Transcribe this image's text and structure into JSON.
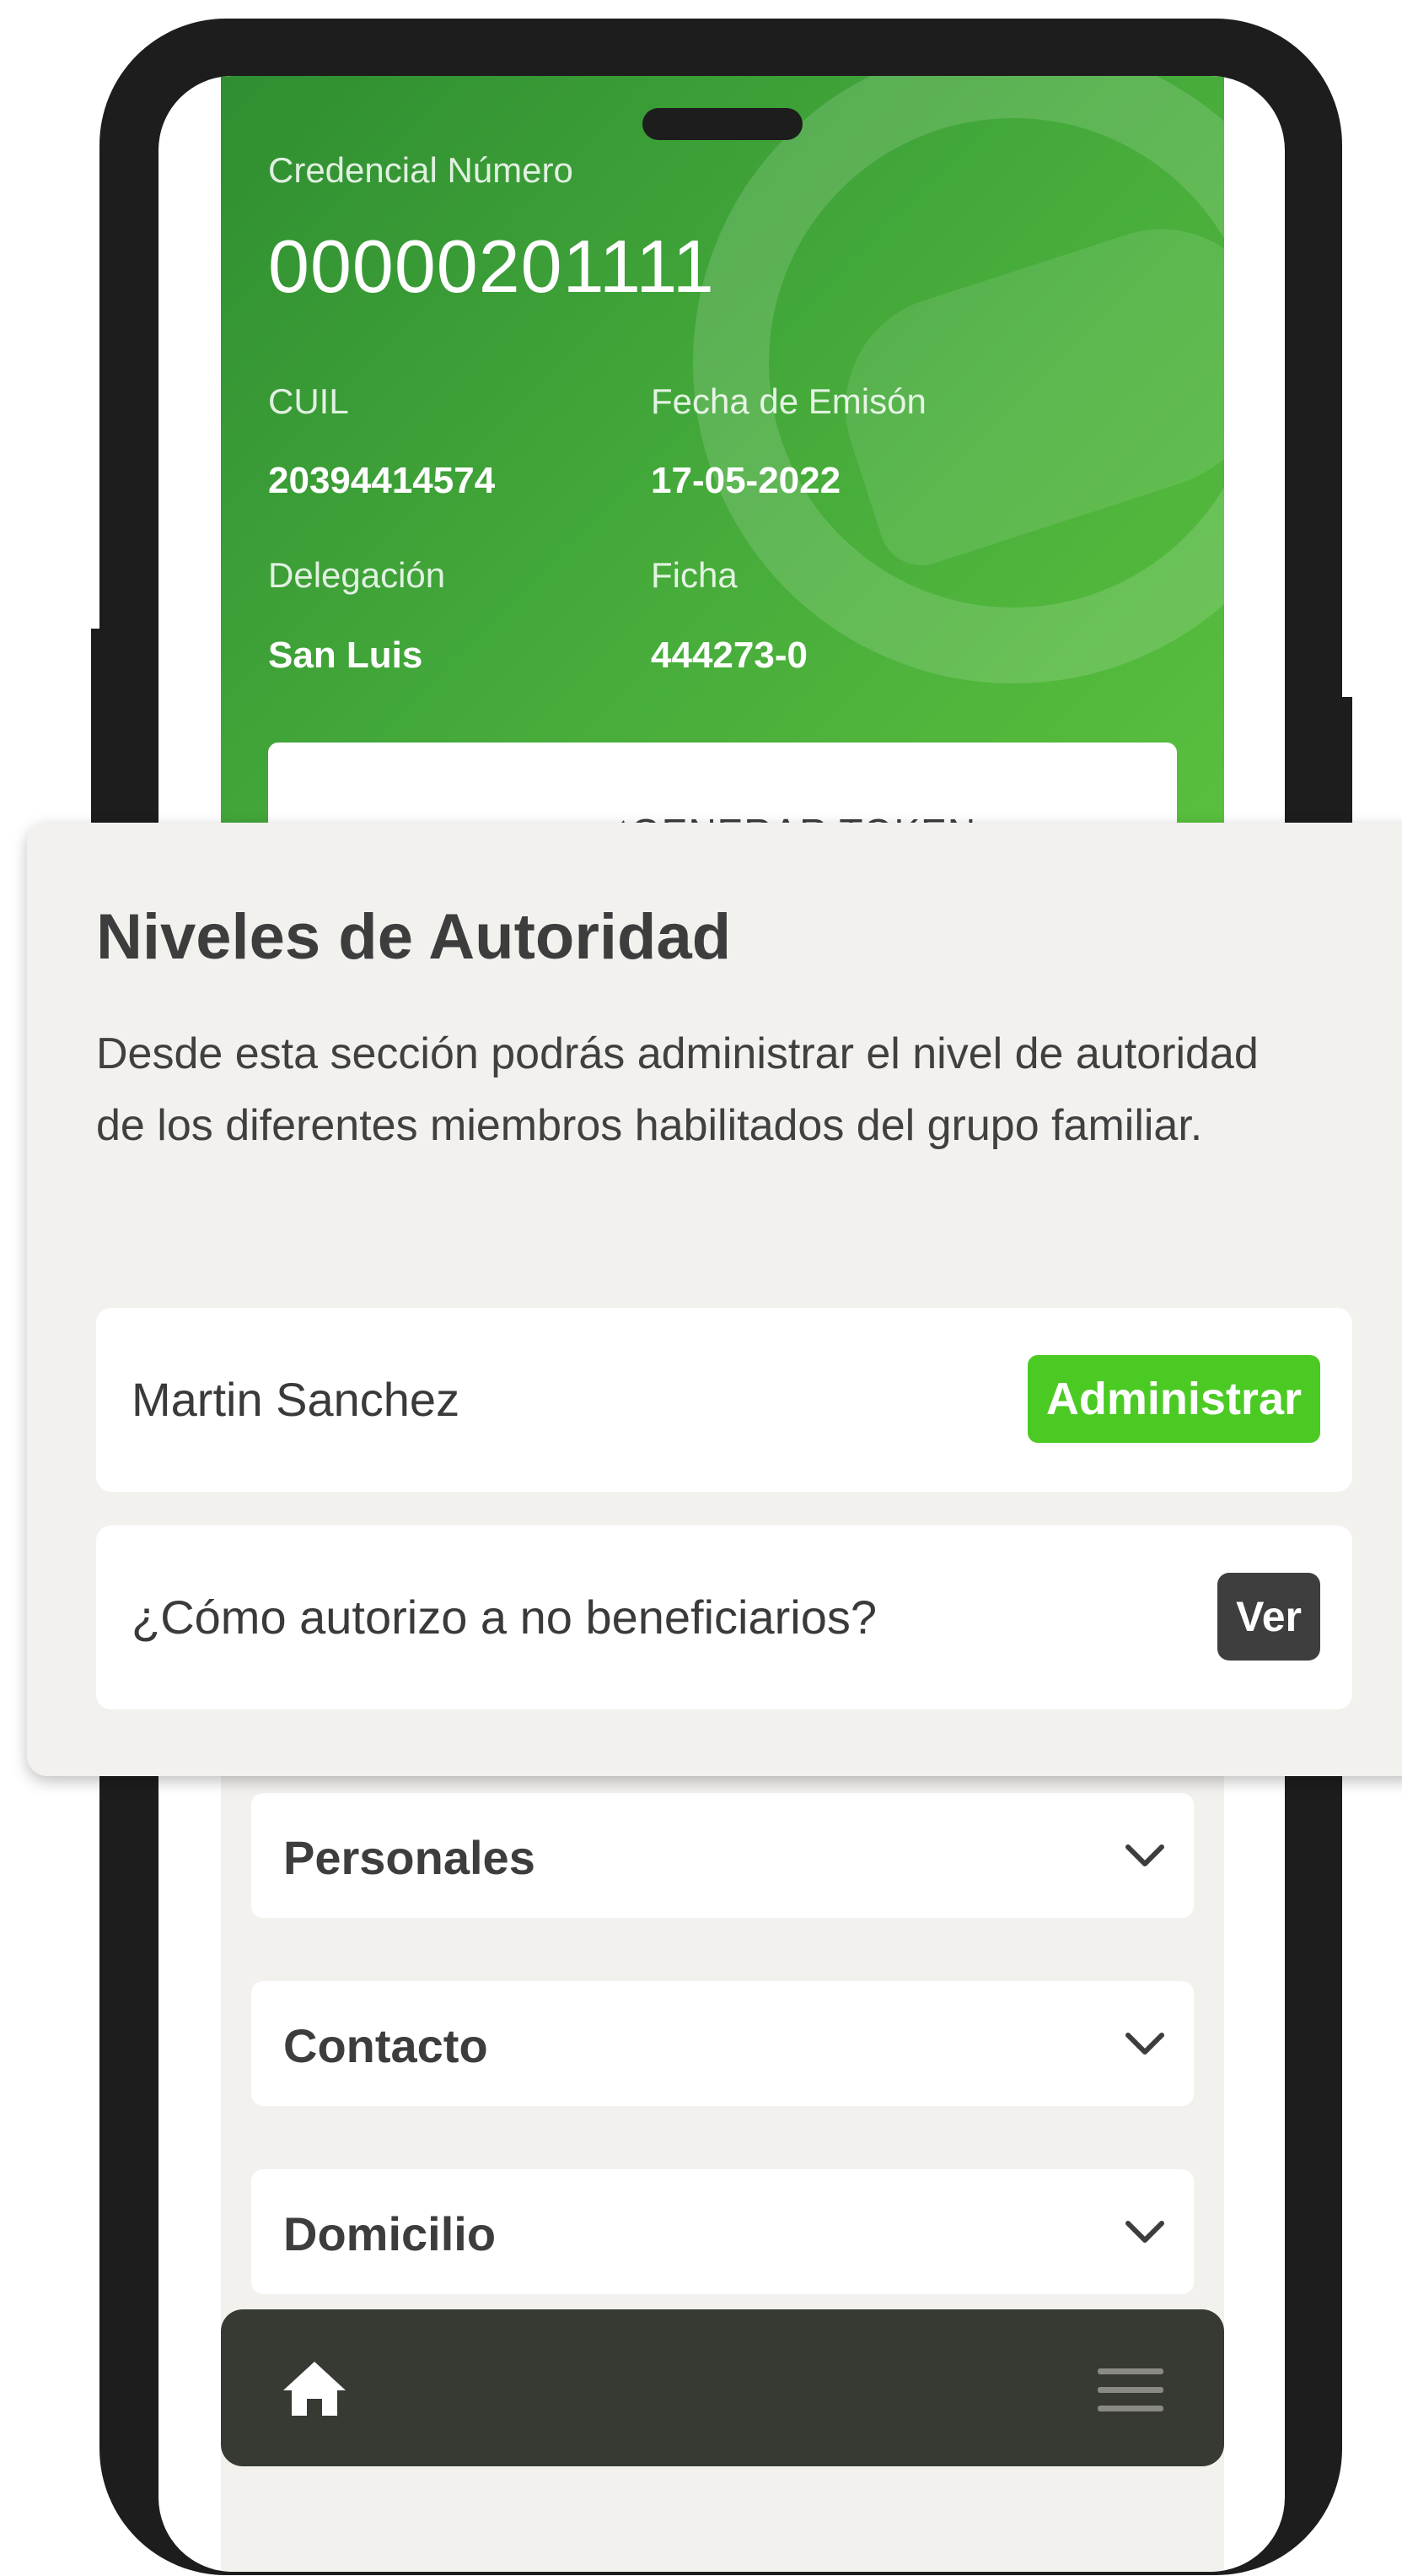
{
  "card": {
    "number_label": "Credencial Número",
    "number": "00000201111",
    "cuil_label": "CUIL",
    "cuil": "20394414574",
    "issue_label": "Fecha de Emisón",
    "issue_date": "17-05-2022",
    "delegation_label": "Delegación",
    "delegation": "San Luis",
    "file_label": "Ficha",
    "file": "444273-0",
    "token_button": "GENERAR TOKEN",
    "token_icon": "key-icon"
  },
  "modal": {
    "title": "Niveles de Autoridad",
    "description": "Desde esta sección podrás administrar el nivel de autoridad de los diferentes miembros habilitados del grupo familiar.",
    "rows": [
      {
        "label": "Martin Sanchez",
        "action": "Administrar",
        "action_color": "#4cca24"
      },
      {
        "label": "¿Cómo autorizo a no beneficiarios?",
        "action": "Ver",
        "action_color": "#3e3e3e"
      }
    ]
  },
  "sections": [
    {
      "title": "Personales",
      "icon": "chevron-down-icon"
    },
    {
      "title": "Contacto",
      "icon": "chevron-down-icon"
    },
    {
      "title": "Domicilio",
      "icon": "chevron-down-icon"
    }
  ],
  "nav": {
    "home_icon": "home-icon",
    "menu_icon": "menu-icon",
    "background": "#363a32"
  },
  "colors": {
    "brand_green": "#43a83a",
    "accent_green": "#4cca24",
    "frame": "#1d1d1d"
  }
}
